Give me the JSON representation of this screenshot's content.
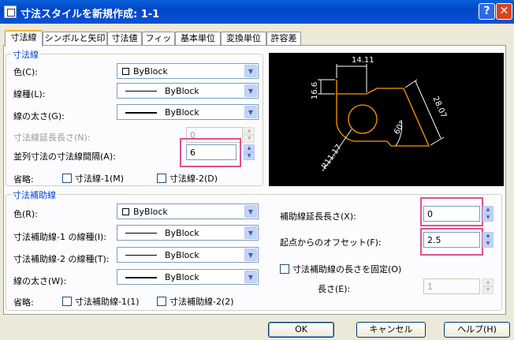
{
  "window": {
    "title": "寸法スタイルを新規作成: 1-1",
    "help": "?",
    "close": "✕"
  },
  "tabs": [
    "寸法線",
    "シンボルと矢印",
    "寸法値",
    "フィット",
    "基本単位",
    "変換単位",
    "許容差"
  ],
  "dimline": {
    "legend": "寸法線",
    "color_label": "色(C):",
    "color_value": "ByBlock",
    "linetype_label": "線種(L):",
    "linetype_value": "ByBlock",
    "lineweight_label": "線の太さ(G):",
    "lineweight_value": "ByBlock",
    "ext_label": "寸法線延長長さ(N):",
    "ext_value": "0",
    "baseline_label": "並列寸法の寸法線間隔(A):",
    "baseline_value": "6",
    "suppress_label": "省略:",
    "suppress1": "寸法線-1(M)",
    "suppress2": "寸法線-2(D)"
  },
  "extline": {
    "legend": "寸法補助線",
    "color_label": "色(R):",
    "color_value": "ByBlock",
    "lt1_label": "寸法補助線-1 の線種(I):",
    "lt1_value": "ByBlock",
    "lt2_label": "寸法補助線-2 の線種(T):",
    "lt2_value": "ByBlock",
    "lw_label": "線の太さ(W):",
    "lw_value": "ByBlock",
    "suppress_label": "省略:",
    "suppress1": "寸法補助線-1(1)",
    "suppress2": "寸法補助線-2(2)",
    "beyond_label": "補助線延長長さ(X):",
    "beyond_value": "0",
    "offset_label": "起点からのオフセット(F):",
    "offset_value": "2.5",
    "fixed_label": "寸法補助線の長さを固定(O)",
    "length_label": "長さ(E):",
    "length_value": "1"
  },
  "preview": {
    "dim_top": "14.11",
    "dim_left": "16.6",
    "dim_diag": "28.07",
    "dim_angle": "60°",
    "dim_radius": "R11.17"
  },
  "buttons": {
    "ok": "OK",
    "cancel": "キャンセル",
    "help": "ヘルプ(H)"
  },
  "colors": {
    "accent": "#0046d5",
    "highlight": "#e05090",
    "preview_line": "#ff9900",
    "preview_dim": "#ffffff"
  }
}
